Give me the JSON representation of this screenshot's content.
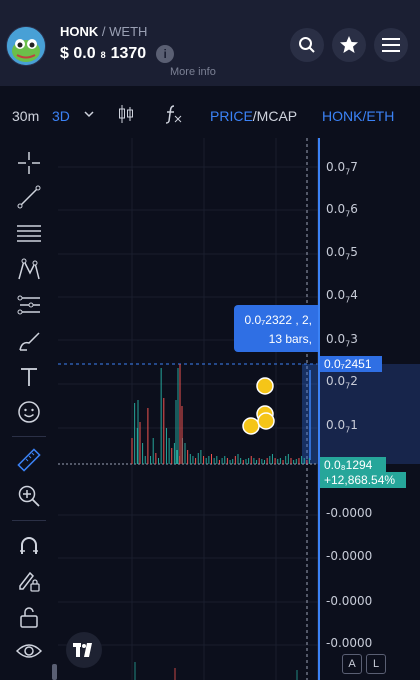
{
  "header": {
    "base_token": "HONK",
    "separator": " / ",
    "quote_token": "WETH",
    "price_prefix": "$ 0.0",
    "price_sub": "8",
    "price_tail": "1370",
    "info_label": "i",
    "more_info": "More info"
  },
  "toolbar": {
    "timeframe_short": "30m",
    "timeframe_active": "3D",
    "price_label": "PRICE",
    "mcap_label": "/MCAP",
    "pair_label": "HONK/ETH"
  },
  "yaxis": {
    "labels": [
      {
        "main": "0.0",
        "sub": "7",
        "tail": "7"
      },
      {
        "main": "0.0",
        "sub": "7",
        "tail": "6"
      },
      {
        "main": "0.0",
        "sub": "7",
        "tail": "5"
      },
      {
        "main": "0.0",
        "sub": "7",
        "tail": "4"
      },
      {
        "main": "0.0",
        "sub": "7",
        "tail": "3"
      },
      {
        "main": "0.0",
        "sub": "7",
        "tail": "2"
      },
      {
        "main": "0.0",
        "sub": "7",
        "tail": "1"
      },
      {
        "main": "-0.0000",
        "sub": "",
        "tail": ""
      },
      {
        "main": "-0.0000",
        "sub": "",
        "tail": ""
      },
      {
        "main": "-0.0000",
        "sub": "",
        "tail": ""
      },
      {
        "main": "-0.0000",
        "sub": "",
        "tail": ""
      }
    ]
  },
  "tooltip": {
    "line1": "0.0₇2322 , 2,",
    "line2": "13 bars,"
  },
  "tags": {
    "crosshair_price": "0.0₇2451",
    "current_price": "0.0₈1294",
    "change": "+12,868.54%"
  },
  "footer": {
    "a_label": "A",
    "l_label": "L"
  },
  "colors": {
    "accent": "#2f6fe4",
    "up": "#26a69a",
    "down": "#ef5350"
  }
}
